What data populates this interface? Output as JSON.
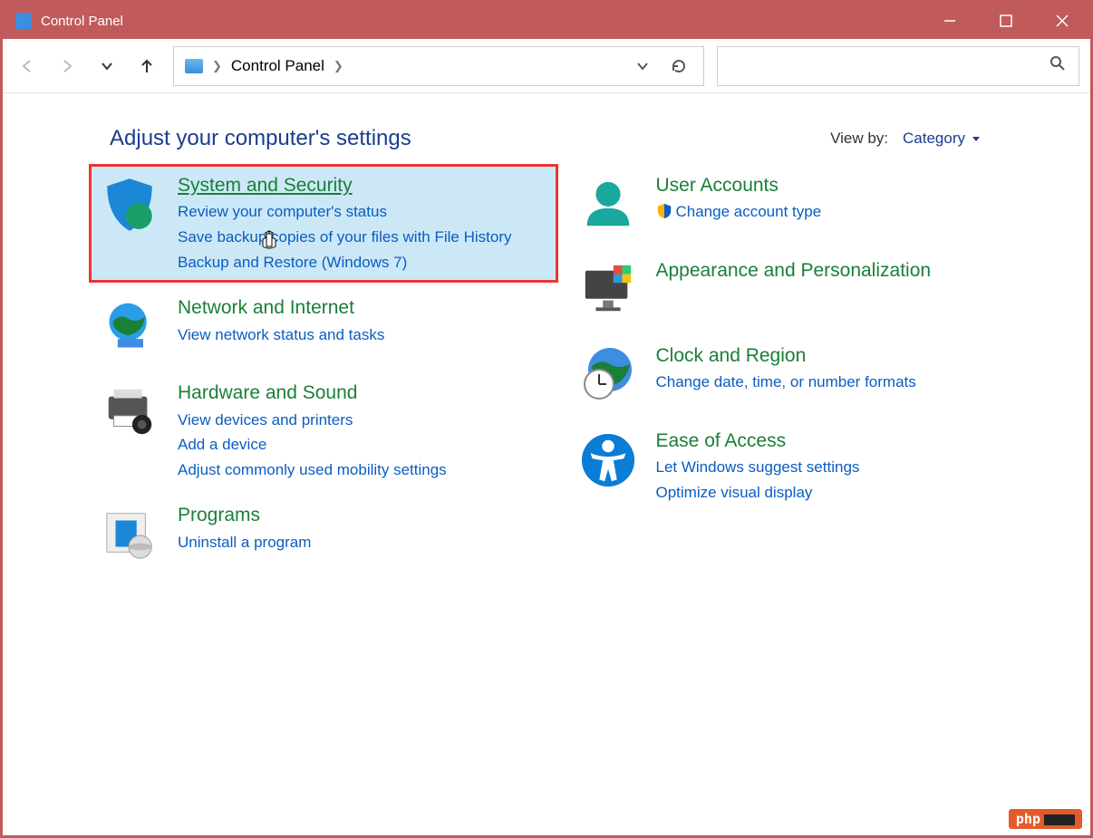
{
  "window_title": "Control Panel",
  "address_bar": {
    "location": "Control Panel"
  },
  "heading": "Adjust your computer's settings",
  "view_by": {
    "label": "View by:",
    "value": "Category"
  },
  "categories_left": [
    {
      "id": "system-security",
      "title": "System and Security",
      "links": [
        "Review your computer's status",
        "Save backup copies of your files with File History",
        "Backup and Restore (Windows 7)"
      ],
      "highlight": true
    },
    {
      "id": "network",
      "title": "Network and Internet",
      "links": [
        "View network status and tasks"
      ]
    },
    {
      "id": "hardware",
      "title": "Hardware and Sound",
      "links": [
        "View devices and printers",
        "Add a device",
        "Adjust commonly used mobility settings"
      ]
    },
    {
      "id": "programs",
      "title": "Programs",
      "links": [
        "Uninstall a program"
      ]
    }
  ],
  "categories_right": [
    {
      "id": "user-accounts",
      "title": "User Accounts",
      "links": [
        "Change account type"
      ],
      "shield_links": [
        0
      ]
    },
    {
      "id": "appearance",
      "title": "Appearance and Personalization",
      "links": []
    },
    {
      "id": "clock",
      "title": "Clock and Region",
      "links": [
        "Change date, time, or number formats"
      ]
    },
    {
      "id": "ease",
      "title": "Ease of Access",
      "links": [
        "Let Windows suggest settings",
        "Optimize visual display"
      ]
    }
  ],
  "watermark": "php"
}
